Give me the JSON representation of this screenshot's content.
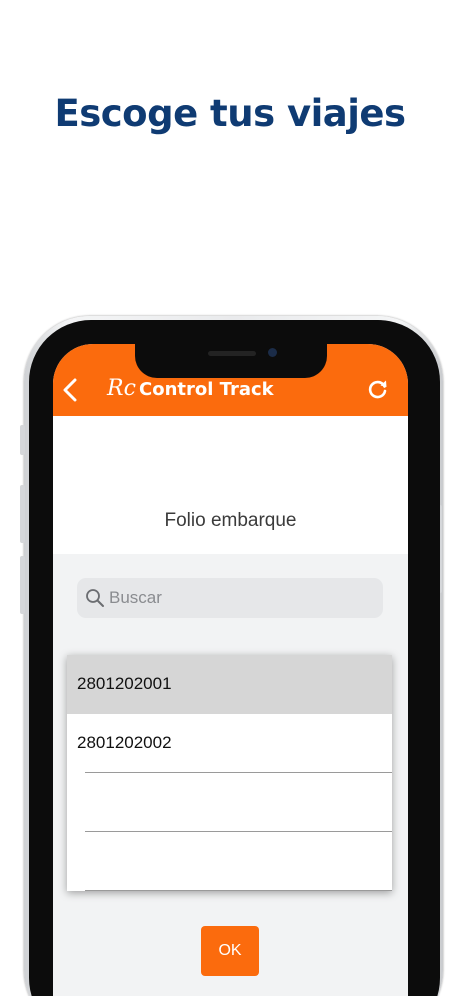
{
  "headline": "Escoge tus viajes",
  "app_bar": {
    "back_icon": "chevron-left-icon",
    "logo_text": "Rc",
    "title": "Control Track",
    "refresh_icon": "refresh-icon"
  },
  "brand_color": "#fb6b0d",
  "headline_color": "#0f3b73",
  "form": {
    "label": "Folio embarque",
    "search_placeholder": "Buscar",
    "search_value": ""
  },
  "list": {
    "items": [
      {
        "label": "2801202001",
        "selected": true
      },
      {
        "label": "2801202002",
        "selected": false
      },
      {
        "label": "",
        "selected": false
      },
      {
        "label": "",
        "selected": false
      }
    ]
  },
  "ok_button": "OK"
}
